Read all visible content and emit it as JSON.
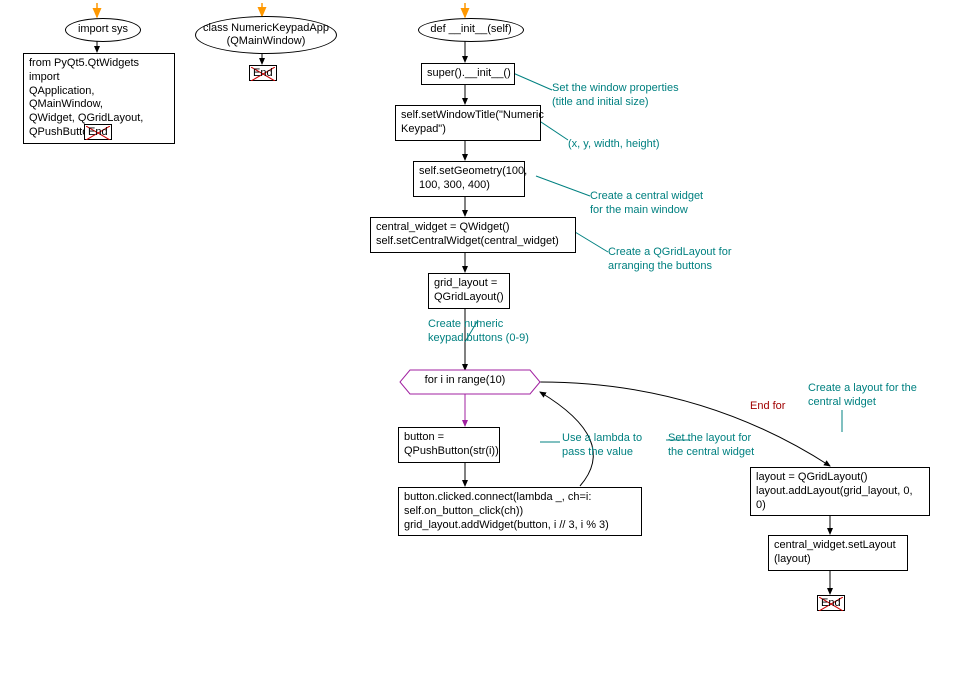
{
  "col1": {
    "import_sys": "import sys",
    "imports": "from PyQt5.QtWidgets import\nQApplication, QMainWindow,\nQWidget, QGridLayout,\nQPushButton",
    "end": "End"
  },
  "col2": {
    "class_def": "class NumericKeypadApp\n(QMainWindow)",
    "end": "End"
  },
  "col3": {
    "def_init": "def __init__(self)",
    "super_init": "super().__init__()",
    "c_windowprops": "Set the window properties\n(title and initial size)",
    "set_title": "self.setWindowTitle(\"Numeric\nKeypad\")",
    "c_geom": "(x, y, width, height)",
    "set_geom": "self.setGeometry(100,\n100, 300, 400)",
    "c_central": "Create a central widget\nfor the main window",
    "central": "central_widget = QWidget()\nself.setCentralWidget(central_widget)",
    "c_grid": "Create a QGridLayout for\narranging the buttons",
    "grid": "grid_layout =\nQGridLayout()",
    "c_keypad": "Create numeric\nkeypad buttons (0-9)",
    "for_loop": "for i in range(10)",
    "button": "button =\nQPushButton(str(i))",
    "c_lambda": "Use a lambda to\npass the value",
    "connect": "button.clicked.connect(lambda _, ch=i:\nself.on_button_click(ch))\ngrid_layout.addWidget(button, i // 3, i % 3)",
    "end_for": "End for",
    "c_setlayout": "Set the layout for\nthe central widget",
    "c_createlayout": "Create a layout for the\ncentral widget",
    "layout": "layout = QGridLayout()\nlayout.addLayout(grid_layout, 0, 0)",
    "setlayout": "central_widget.setLayout\n(layout)",
    "end": "End"
  }
}
